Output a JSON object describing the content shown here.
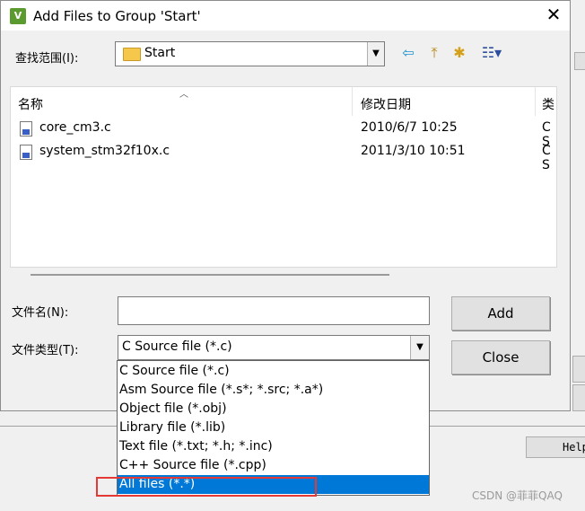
{
  "dialog": {
    "title": "Add Files to Group 'Start'",
    "app_icon_text": "V",
    "close_glyph": "✕"
  },
  "look_in": {
    "label": "查找范围(I):",
    "value": "Start"
  },
  "toolbar": {
    "back_glyph": "⇦",
    "up_glyph": "⤒",
    "new_folder_glyph": "✱",
    "view_glyph": "☷▾"
  },
  "file_list": {
    "columns": [
      "名称",
      "修改日期",
      "类"
    ],
    "rows": [
      {
        "name": "core_cm3.c",
        "date": "2010/6/7 10:25",
        "type": "C S"
      },
      {
        "name": "system_stm32f10x.c",
        "date": "2011/3/10 10:51",
        "type": "C S"
      }
    ]
  },
  "file_name": {
    "label": "文件名(N):",
    "value": ""
  },
  "file_type": {
    "label": "文件类型(T):",
    "value": "C Source file (*.c)",
    "options": [
      "C Source file (*.c)",
      "Asm Source file (*.s*; *.src; *.a*)",
      "Object file (*.obj)",
      "Library file (*.lib)",
      "Text file (*.txt; *.h; *.inc)",
      "C++ Source file (*.cpp)",
      "All files (*.*)"
    ],
    "highlighted_option": "All files (*.*)"
  },
  "buttons": {
    "add": "Add",
    "close": "Close"
  },
  "background": {
    "help_label": "Help"
  },
  "watermark": "CSDN @菲菲QAQ",
  "colors": {
    "selection": "#0078d7",
    "annotation_box": "#e53935"
  }
}
